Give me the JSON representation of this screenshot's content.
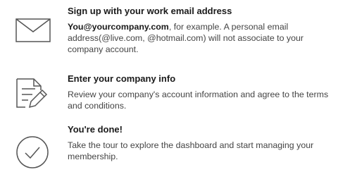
{
  "steps": [
    {
      "icon": "envelope-icon",
      "title": "Sign up with your work email address",
      "email_example": "You@yourcompany.com",
      "description": ", for example. A personal email address(@live.com, @hotmail.com) will not associate to your company account."
    },
    {
      "icon": "document-edit-icon",
      "title": "Enter your company info",
      "description": "Review your company's account information and agree to the terms and conditions."
    },
    {
      "icon": "checkmark-circle-icon",
      "title": "You're done!",
      "description": "Take the tour to explore the dashboard and start managing your membership."
    }
  ]
}
